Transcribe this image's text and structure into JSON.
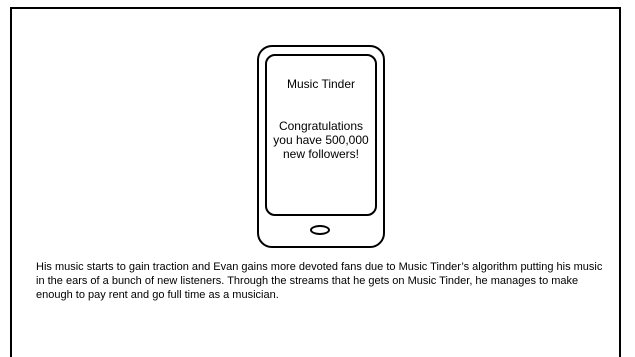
{
  "phone": {
    "app_title": "Music Tinder",
    "notification": "Congratulations you have 500,000 new followers!"
  },
  "caption": "His music starts to gain traction and Evan gains more devoted fans due to Music Tinder’s algorithm putting his music in the ears of a bunch of new listeners. Through the streams that he gets on Music Tinder, he manages to make enough to pay rent and go full time as a musician."
}
